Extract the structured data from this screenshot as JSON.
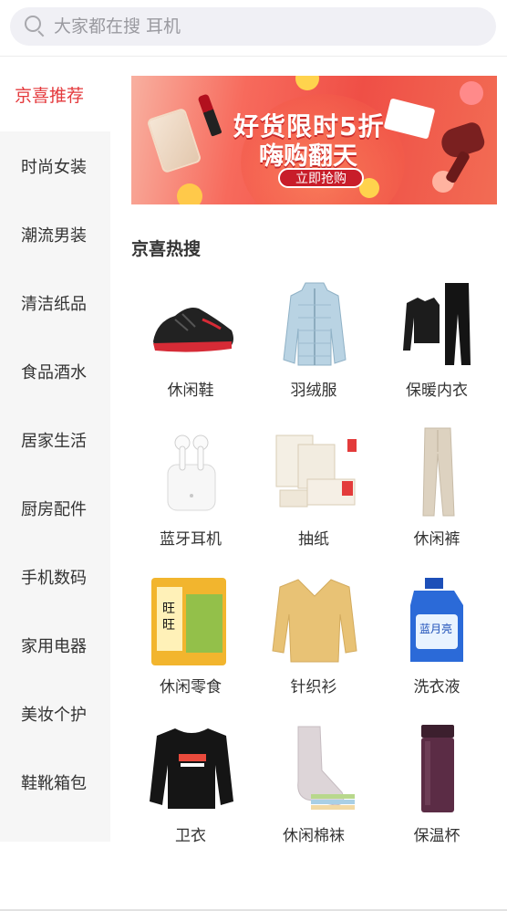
{
  "search": {
    "placeholder": "大家都在搜 耳机"
  },
  "sidebar": {
    "items": [
      {
        "label": "京喜推荐",
        "active": true
      },
      {
        "label": "时尚女装"
      },
      {
        "label": "潮流男装"
      },
      {
        "label": "清洁纸品"
      },
      {
        "label": "食品酒水"
      },
      {
        "label": "居家生活"
      },
      {
        "label": "厨房配件"
      },
      {
        "label": "手机数码"
      },
      {
        "label": "家用电器"
      },
      {
        "label": "美妆个护"
      },
      {
        "label": "鞋靴箱包"
      }
    ]
  },
  "banner": {
    "headline": "好货限时5折",
    "subheadline": "嗨购翻天",
    "cta": "立即抢购"
  },
  "section": {
    "title": "京喜热搜"
  },
  "products": [
    {
      "label": "休闲鞋",
      "icon": "sneaker-image"
    },
    {
      "label": "羽绒服",
      "icon": "down-jacket-image"
    },
    {
      "label": "保暖内衣",
      "icon": "thermal-underwear-image"
    },
    {
      "label": "蓝牙耳机",
      "icon": "bluetooth-earbuds-image"
    },
    {
      "label": "抽纸",
      "icon": "tissue-paper-image"
    },
    {
      "label": "休闲裤",
      "icon": "casual-pants-image"
    },
    {
      "label": "休闲零食",
      "icon": "snack-image"
    },
    {
      "label": "针织衫",
      "icon": "knit-sweater-image"
    },
    {
      "label": "洗衣液",
      "icon": "laundry-detergent-image"
    },
    {
      "label": "卫衣",
      "icon": "sweatshirt-image"
    },
    {
      "label": "休闲棉袜",
      "icon": "cotton-socks-image"
    },
    {
      "label": "保温杯",
      "icon": "thermos-cup-image"
    }
  ],
  "colors": {
    "accent": "#e4393c",
    "sidebar_bg": "#f6f6f6",
    "search_bg": "#f0f0f5"
  }
}
